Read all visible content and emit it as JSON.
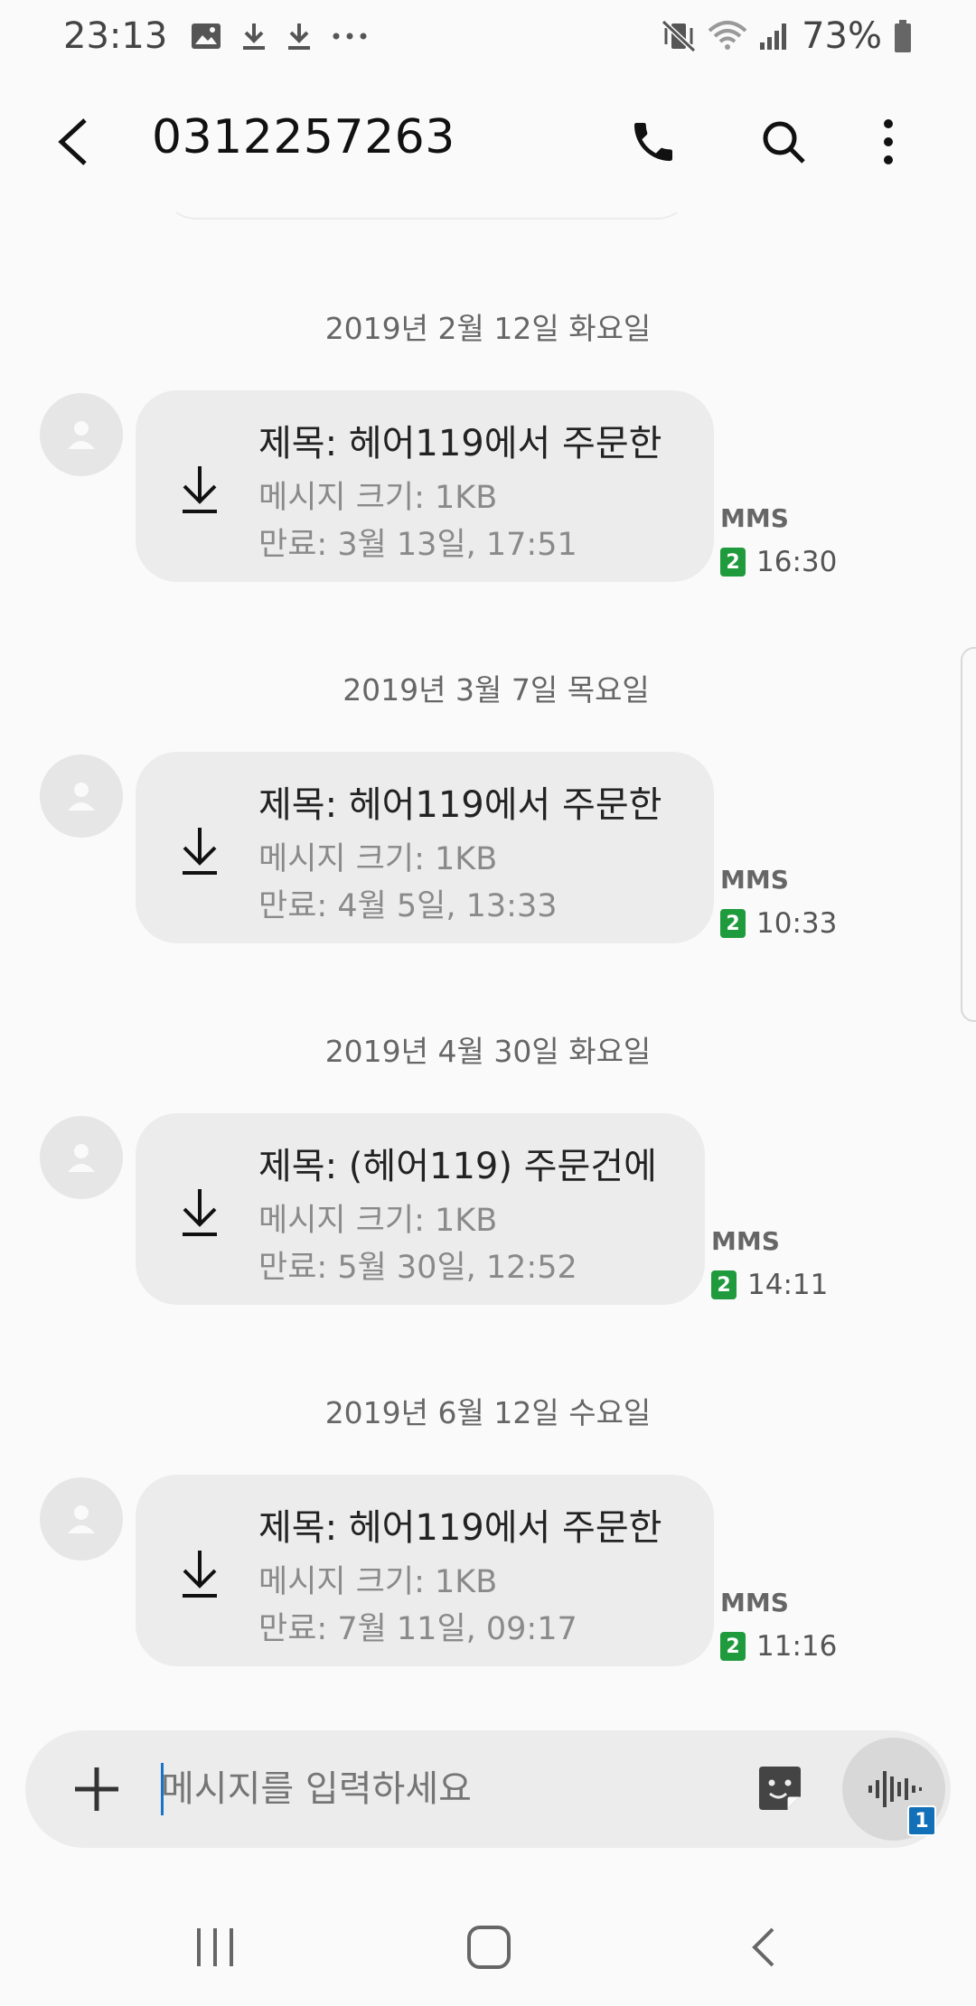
{
  "status_bar": {
    "time": "23:13",
    "battery_percent": "73%",
    "left_icons": [
      "gallery-icon",
      "download-icon",
      "download-icon",
      "more-notifications-icon"
    ],
    "right_icons": [
      "vibrate-mute-icon",
      "wifi-icon",
      "signal-icon",
      "battery-icon"
    ]
  },
  "app_bar": {
    "title": "0312257263",
    "actions": [
      "phone-icon",
      "search-icon",
      "more-vert-icon"
    ]
  },
  "messages": [
    {
      "date": "2019년 2월 12일 화요일",
      "subject": "제목: 헤어119에서 주문한",
      "size": "메시지 크기: 1KB",
      "expiry": "만료: 3월 13일, 17:51",
      "type": "MMS",
      "sim": "2",
      "time": "16:30"
    },
    {
      "date": "2019년 3월 7일 목요일",
      "subject": "제목: 헤어119에서 주문한",
      "size": "메시지 크기: 1KB",
      "expiry": "만료: 4월 5일, 13:33",
      "type": "MMS",
      "sim": "2",
      "time": "10:33"
    },
    {
      "date": "2019년 4월 30일 화요일",
      "subject": "제목: (헤어119) 주문건에",
      "size": "메시지 크기: 1KB",
      "expiry": "만료: 5월 30일, 12:52",
      "type": "MMS",
      "sim": "2",
      "time": "14:11"
    },
    {
      "date": "2019년 6월 12일 수요일",
      "subject": "제목: 헤어119에서 주문한",
      "size": "메시지 크기: 1KB",
      "expiry": "만료: 7월 11일, 09:17",
      "type": "MMS",
      "sim": "2",
      "time": "11:16"
    }
  ],
  "composer": {
    "placeholder": "메시지를 입력하세요",
    "voice_badge": "1"
  },
  "colors": {
    "sim_badge": "#1f9a3c",
    "voice_badge": "#1270b8",
    "bubble": "#ececec",
    "background": "#fafafa"
  }
}
